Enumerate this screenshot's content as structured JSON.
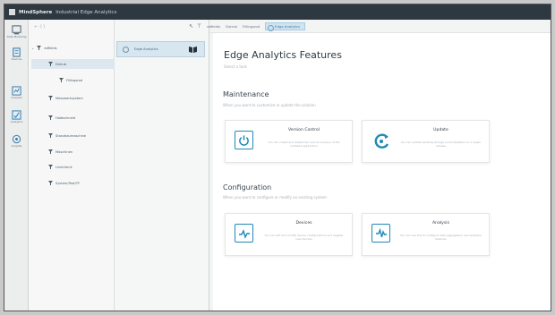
{
  "titlebar": {
    "brand": "MindSphere",
    "title": "Industrial Edge Analytics"
  },
  "rail": {
    "items": [
      {
        "label": "Data Modeling",
        "icon": "database-icon"
      },
      {
        "label": "Devices",
        "icon": "device-icon"
      },
      {
        "label": "Analysis",
        "icon": "chart-icon"
      },
      {
        "label": "Analytics",
        "icon": "analytics-icon"
      },
      {
        "label": "Insights",
        "icon": "insight-icon"
      }
    ]
  },
  "tree": {
    "toolbar": "+ - [ ]",
    "nodes": [
      {
        "label": "edfields",
        "indent": 0,
        "selected": false
      },
      {
        "label": "Dstrub",
        "indent": 1,
        "selected": true
      },
      {
        "label": "Fillingsrod",
        "indent": 2,
        "selected": false
      },
      {
        "label": "Messwerksystem",
        "indent": 1,
        "selected": false
      },
      {
        "label": "Halbschneid",
        "indent": 1,
        "selected": false
      },
      {
        "label": "Stanzbaumaschine",
        "indent": 1,
        "selected": false
      },
      {
        "label": "Maschinen",
        "indent": 1,
        "selected": false
      },
      {
        "label": "Linienfunk",
        "indent": 1,
        "selected": false
      },
      {
        "label": "System/Test/TF",
        "indent": 1,
        "selected": false
      }
    ]
  },
  "mid": {
    "item_label": "Edge Analytics"
  },
  "topbar": {
    "crumbs": [
      "edfields",
      "Dstrub",
      "Fillingsrod"
    ],
    "active": "Edge Analytics"
  },
  "main": {
    "title": "Edge Analytics Features",
    "subtitle": "Select a task",
    "maintenance": {
      "title": "Maintenance",
      "desc": "When you want to customize or update the solution",
      "cards": [
        {
          "title": "Version Control",
          "desc": "You can create and delete the various versions of the installed application"
        },
        {
          "title": "Update",
          "desc": "You can update existing storage and installation to a newer release"
        }
      ]
    },
    "configuration": {
      "title": "Configuration",
      "desc": "When you want to configure or modify an existing system",
      "cards": [
        {
          "title": "Devices",
          "desc": "You can add and modify device configurations and register new devices"
        },
        {
          "title": "Analysis",
          "desc": "You can use this to configure data aggregation and analytics features"
        }
      ]
    }
  },
  "colors": {
    "accent": "#1f89b7",
    "titlebar": "#2d3841"
  }
}
